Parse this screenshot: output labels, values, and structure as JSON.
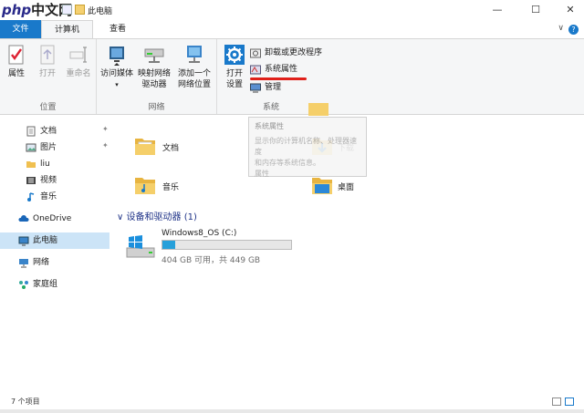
{
  "window": {
    "title": "此电脑",
    "logo_text": "php",
    "logo_cn": "中文网",
    "min_glyph": "—",
    "max_glyph": "☐",
    "close_glyph": "✕"
  },
  "tabs": {
    "file": "文件",
    "computer": "计算机",
    "view": "查看",
    "help": "?",
    "collapse": "∨"
  },
  "ribbon": {
    "location": {
      "label": "位置",
      "properties": "属性",
      "open": "打开",
      "rename": "重命名"
    },
    "network": {
      "label": "网络",
      "access_media": "访问媒体",
      "map_drive_1": "映射网络",
      "map_drive_2": "驱动器",
      "add_location_1": "添加一个",
      "add_location_2": "网络位置"
    },
    "system": {
      "label": "系统",
      "open_settings_1": "打开",
      "open_settings_2": "设置",
      "uninstall": "卸载或更改程序",
      "system_properties": "系统属性",
      "manage": "管理"
    }
  },
  "tooltip": {
    "title": "系统属性",
    "line1": "显示你的计算机名称、处理器速度",
    "line2": "和内存等系统信息。",
    "line3": "属性"
  },
  "nav": {
    "items": [
      {
        "label": "文档"
      },
      {
        "label": "图片"
      },
      {
        "label": "liu"
      },
      {
        "label": "视频"
      },
      {
        "label": "音乐"
      },
      {
        "label": "OneDrive"
      },
      {
        "label": "此电脑"
      },
      {
        "label": "网络"
      },
      {
        "label": "家庭组"
      }
    ],
    "pin": "✦"
  },
  "content": {
    "folders": [
      {
        "label": "文档"
      },
      {
        "label": "下载"
      },
      {
        "label": "音乐"
      },
      {
        "label": "桌面"
      }
    ],
    "section_header": "设备和驱动器 (1)",
    "section_chevron": "∨",
    "drive": {
      "name": "Windows8_OS (C:)",
      "free_text": "404 GB 可用，共 449 GB",
      "used_fraction": 0.1
    }
  },
  "status": {
    "items": "7 个项目"
  },
  "colors": {
    "accent": "#1979ca",
    "folder": "#f0c050",
    "bar_fill": "#26a0da",
    "annotation": "#e0201a"
  }
}
